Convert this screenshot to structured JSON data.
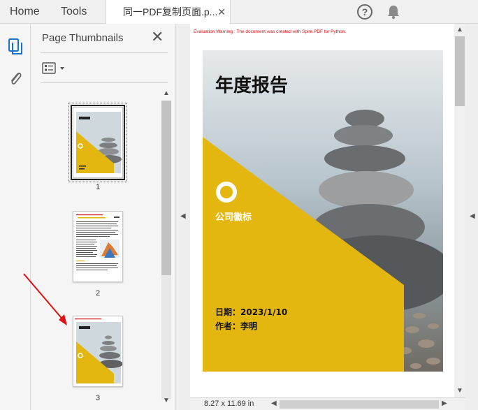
{
  "tabs": {
    "home": "Home",
    "tools": "Tools",
    "document": "同一PDF复制页面.p...",
    "document_close": "✕"
  },
  "header_icons": {
    "help": "?",
    "help_icon": "help-circle-icon",
    "notifications_icon": "bell-icon"
  },
  "rail": {
    "pages_icon": "page-thumbnails-icon",
    "attachments_icon": "paperclip-icon"
  },
  "panel": {
    "title": "Page Thumbnails",
    "close": "✕",
    "options_icon": "thumbnail-options-icon"
  },
  "thumbnails": [
    {
      "number": "1",
      "selected": true
    },
    {
      "number": "2",
      "selected": false
    },
    {
      "number": "3",
      "selected": false
    }
  ],
  "document": {
    "eval_warning": "Evaluation Warning : The document was created with Spire.PDF for Python.",
    "cover": {
      "title": "年度报告",
      "logo_text": "公司徽标",
      "date_line": "日期：2023/1/10",
      "author_line": "作者：李明"
    }
  },
  "status": {
    "page_size": "8.27 x 11.69 in"
  },
  "colors": {
    "accent_yellow": "#E3B70F",
    "annotation_red": "#E01010"
  }
}
